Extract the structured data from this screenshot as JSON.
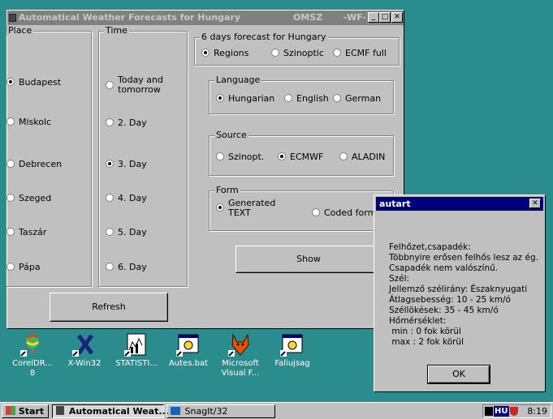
{
  "window": {
    "title": "Automatical Weather Forecasts for Hungary",
    "title_omsz": "OMSZ",
    "title_wf": "-WF-",
    "min_glyph": "_",
    "max_glyph": "□",
    "close_glyph": "✕"
  },
  "place": {
    "legend": "Place",
    "options": [
      "Budapest",
      "Miskolc",
      "Debrecen",
      "Szeged",
      "Taszár",
      "Pápa"
    ],
    "selected": "Budapest"
  },
  "time": {
    "legend": "Time",
    "options": [
      "Today and tomorrow",
      "2. Day",
      "3. Day",
      "4. Day",
      "5. Day",
      "6. Day"
    ],
    "option1_line1": "Today and",
    "option1_line2": "tomorrow",
    "selected": "3. Day"
  },
  "forecast6": {
    "legend": "6 days forecast for Hungary",
    "options": [
      "Regions",
      "Szinoptic",
      "ECMF full"
    ],
    "selected": "Regions"
  },
  "language": {
    "legend": "Language",
    "options": [
      "Hungarian",
      "English",
      "German"
    ],
    "selected": "Hungarian"
  },
  "source": {
    "legend": "Source",
    "options": [
      "Szinopt.",
      "ECMWF",
      "ALADIN"
    ],
    "selected": "ECMWF"
  },
  "form": {
    "legend": "Form",
    "generated_line1": "Generated",
    "generated_line2": "TEXT",
    "coded": "Coded form",
    "selected": "Generated TEXT"
  },
  "buttons": {
    "show": "Show",
    "refresh": "Refresh"
  },
  "desktop_icons": [
    {
      "icon": "coreldraw-balloon-icon",
      "line1": "CorelDR...",
      "line2": "8"
    },
    {
      "icon": "x-win32-icon",
      "line1": "X-Win32",
      "line2": ""
    },
    {
      "icon": "statistica-icon",
      "line1": "STATISTI...",
      "line2": ""
    },
    {
      "icon": "batch-file-icon",
      "line1": "Autes.bat",
      "line2": ""
    },
    {
      "icon": "visual-foxpro-icon",
      "line1": "Microsoft",
      "line2": "Visual F..."
    },
    {
      "icon": "batch-file-icon",
      "line1": "Faliujsag",
      "line2": ""
    }
  ],
  "dialog": {
    "title": "autart",
    "close_glyph": "✕",
    "lines": [
      "Felhőzet,csapadék:",
      "Többnyire erősen felhős lesz az ég.",
      "Csapadék nem valószínű.",
      "Szél:",
      "Jellemző szélirány: Északnyugati",
      "Átlagsebesség:  10 - 25 km/ó",
      "Széllökések:   35 - 45 km/ó",
      "Hőmérséklet:",
      " min : 0 fok körül",
      " max : 2 fok körül"
    ],
    "ok": "OK"
  },
  "taskbar": {
    "start": "Start",
    "task1": "Automatical Weat...",
    "task2": "SnagIt/32",
    "tray_lang": "HU",
    "clock": "8:19"
  },
  "colors": {
    "desktop": "#2a8c8c",
    "inactive_title": "#808080",
    "active_title": "#00007b",
    "face": "#c0c0c0"
  }
}
